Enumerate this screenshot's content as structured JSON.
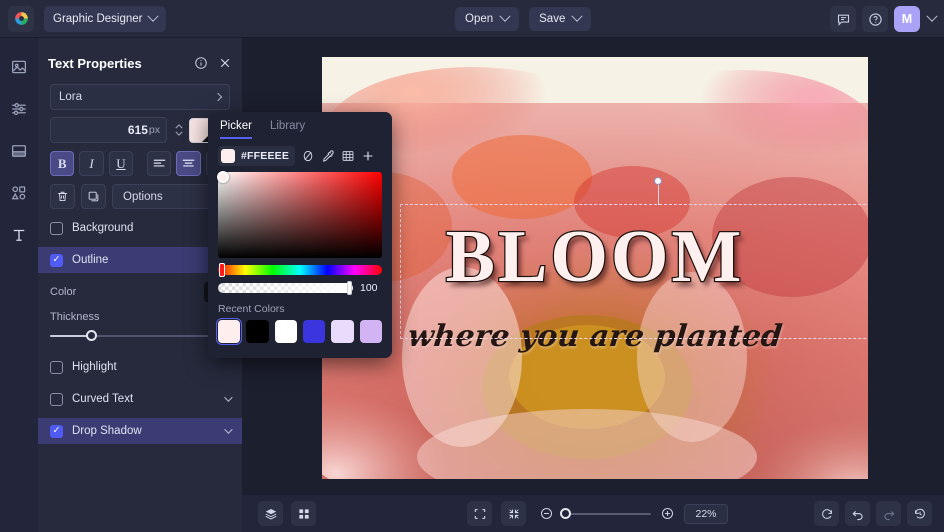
{
  "topbar": {
    "logo_icon": "color-wheel-logo-icon",
    "document_name": "Graphic Designer",
    "open_label": "Open",
    "save_label": "Save",
    "comment_icon": "comment-icon",
    "help_icon": "help-circle-icon",
    "avatar_initial": "M"
  },
  "rail": {
    "items": [
      {
        "icon": "image-icon",
        "name": "image"
      },
      {
        "icon": "adjustments-icon",
        "name": "adjust"
      },
      {
        "icon": "layout-icon",
        "name": "layout"
      },
      {
        "icon": "shapes-icon",
        "name": "shapes"
      },
      {
        "icon": "text-icon",
        "name": "text"
      }
    ]
  },
  "panel": {
    "title": "Text Properties",
    "info_icon": "info-circle-icon",
    "close_icon": "close-icon",
    "font_family": "Lora",
    "font_size_value": "615",
    "font_size_unit": "px",
    "fill_swatch_color": "#f8e4e2",
    "style_buttons": [
      {
        "label": "B",
        "name": "bold",
        "active": true
      },
      {
        "label": "I",
        "name": "italic",
        "active": false
      },
      {
        "label": "U",
        "name": "underline",
        "active": false
      }
    ],
    "align_buttons": [
      {
        "name": "align-left",
        "active": false
      },
      {
        "name": "align-center",
        "active": true
      },
      {
        "name": "align-right",
        "active": false
      }
    ],
    "delete_icon": "trash-icon",
    "duplicate_icon": "duplicate-icon",
    "options_label": "Options",
    "effects": [
      {
        "label": "Background",
        "checked": false,
        "has_chevron": false,
        "selected": false
      },
      {
        "label": "Outline",
        "checked": true,
        "has_chevron": false,
        "selected": true
      },
      {
        "label": "Highlight",
        "checked": false,
        "has_chevron": false,
        "selected": false
      },
      {
        "label": "Curved Text",
        "checked": false,
        "has_chevron": true,
        "selected": false
      },
      {
        "label": "Drop Shadow",
        "checked": true,
        "has_chevron": true,
        "selected": true
      }
    ],
    "outline": {
      "color_label": "Color",
      "color_value": "#14151d",
      "thickness_label": "Thickness",
      "thickness_value": "23%",
      "thickness_percent": 23
    }
  },
  "color_picker": {
    "tabs": [
      {
        "label": "Picker",
        "active": true
      },
      {
        "label": "Library",
        "active": false
      }
    ],
    "hex_value": "#FFEEEE",
    "swatch_color": "#FFEEEE",
    "tool_icons": [
      {
        "name": "no-color-icon"
      },
      {
        "name": "eyedropper-icon"
      },
      {
        "name": "grid-palette-icon"
      },
      {
        "name": "add-color-icon"
      }
    ],
    "alpha_value": "100",
    "recent_label": "Recent Colors",
    "recent_colors": [
      {
        "hex": "#FFEEEE",
        "selected": true
      },
      {
        "hex": "#000000",
        "selected": false
      },
      {
        "hex": "#FFFFFF",
        "selected": false
      },
      {
        "hex": "#3A35DE",
        "selected": false
      },
      {
        "hex": "#E8DBFB",
        "selected": false
      },
      {
        "hex": "#D2B4F5",
        "selected": false
      }
    ]
  },
  "canvas": {
    "headline_text": "BLOOM",
    "subhead_text": "where you are planted",
    "background_description": "pink and coral peony flower photograph"
  },
  "bottombar": {
    "layers_icon": "layers-icon",
    "grid_icon": "grid-view-icon",
    "fit_icon": "fit-screen-icon",
    "shrink_icon": "shrink-icon",
    "zoom_out_icon": "zoom-out-icon",
    "zoom_in_icon": "zoom-in-icon",
    "zoom_value": "22%",
    "zoom_percent": 22,
    "refresh_icon": "refresh-icon",
    "undo_icon": "undo-icon",
    "redo_icon": "redo-icon",
    "history_icon": "history-icon"
  }
}
